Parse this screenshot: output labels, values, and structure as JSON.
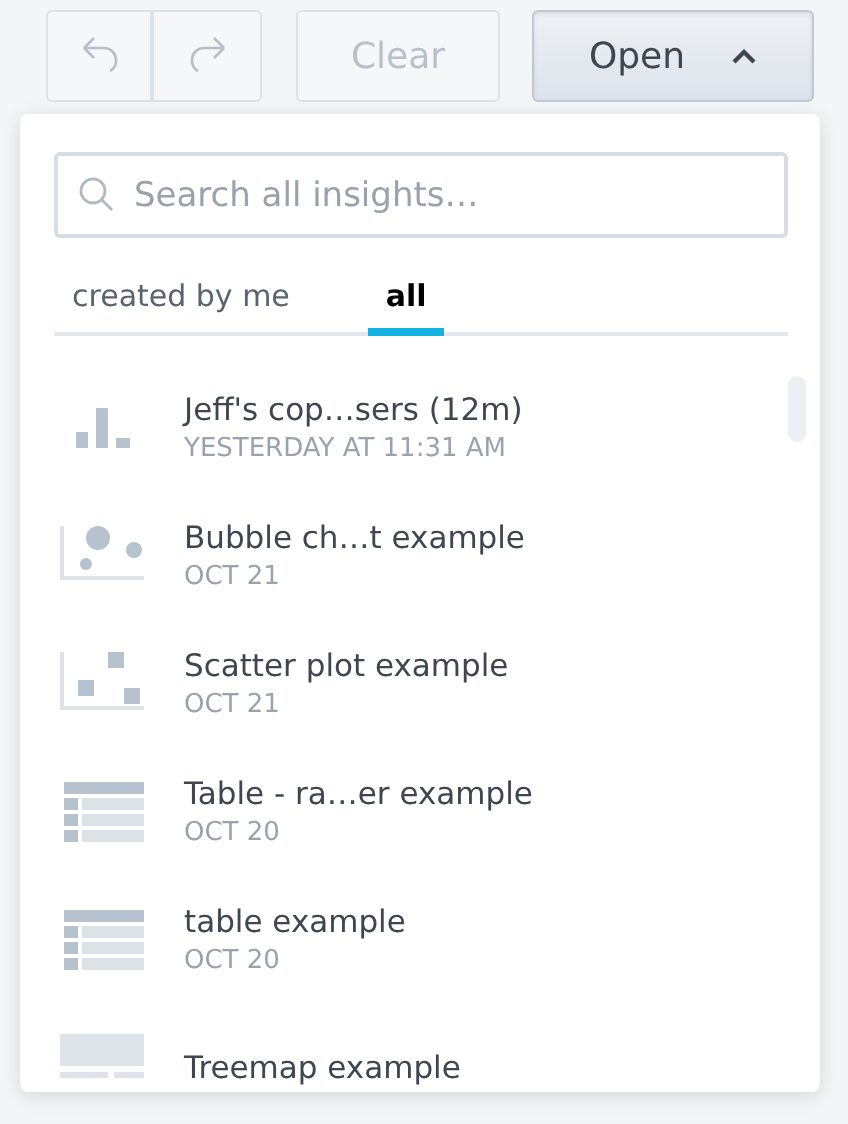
{
  "toolbar": {
    "clear": {
      "label": "Clear",
      "disabled": true
    },
    "open": {
      "label": "Open",
      "expanded": true
    }
  },
  "dropdown": {
    "search": {
      "placeholder": "Search all insights…"
    },
    "tabs": [
      {
        "label": "created by me",
        "selected": false
      },
      {
        "label": "all",
        "selected": true
      }
    ],
    "items": [
      {
        "kind": "bar",
        "title": "Jeff's cop…sers (12m)",
        "date": "YESTERDAY AT 11:31 AM"
      },
      {
        "kind": "bubble",
        "title": "Bubble ch…t example",
        "date": "OCT 21"
      },
      {
        "kind": "scatter",
        "title": "Scatter plot example",
        "date": "OCT 21"
      },
      {
        "kind": "table",
        "title": "Table - ra…er example",
        "date": "OCT 20"
      },
      {
        "kind": "table",
        "title": "table example",
        "date": "OCT 20"
      },
      {
        "kind": "treemap",
        "title": "Treemap example"
      }
    ]
  }
}
